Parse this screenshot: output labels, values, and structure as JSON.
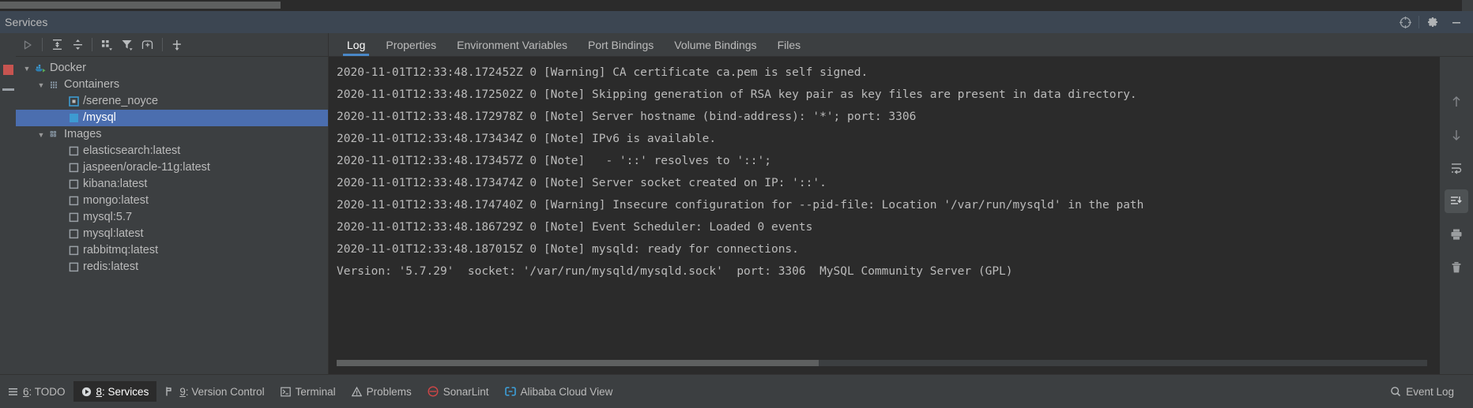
{
  "window": {
    "title": "Services",
    "header_actions": [
      {
        "name": "locate-icon",
        "label": "Locate"
      },
      {
        "name": "settings-gear-icon",
        "label": "Settings"
      },
      {
        "name": "minimize-icon",
        "label": "Hide"
      }
    ]
  },
  "left_toolbar": {
    "buttons": [
      {
        "name": "run-icon",
        "label": "Run"
      },
      {
        "name": "expand-all-icon",
        "label": "Expand All"
      },
      {
        "name": "collapse-all-icon",
        "label": "Collapse All"
      },
      {
        "name": "group-by-icon",
        "label": "Group By"
      },
      {
        "name": "filter-icon",
        "label": "Filter"
      },
      {
        "name": "add-tab-icon",
        "label": "Add Tab"
      },
      {
        "name": "add-service-icon",
        "label": "Add Service"
      }
    ]
  },
  "gutter": {
    "stop_label": "Stop",
    "hide_label": "Hide"
  },
  "tree": {
    "nodes": [
      {
        "label": "Docker",
        "indent": 0,
        "arrow": "expanded",
        "icon": "docker-icon",
        "selected": false
      },
      {
        "label": "Containers",
        "indent": 1,
        "arrow": "expanded",
        "icon": "containers-icon",
        "selected": false
      },
      {
        "label": "/serene_noyce",
        "indent": 2,
        "arrow": "none",
        "icon": "container-stopped-icon",
        "selected": false
      },
      {
        "label": "/mysql",
        "indent": 2,
        "arrow": "none",
        "icon": "container-running-icon",
        "selected": true
      },
      {
        "label": "Images",
        "indent": 1,
        "arrow": "expanded",
        "icon": "images-icon",
        "selected": false
      },
      {
        "label": "elasticsearch:latest",
        "indent": 2,
        "arrow": "none",
        "icon": "image-icon",
        "selected": false
      },
      {
        "label": "jaspeen/oracle-11g:latest",
        "indent": 2,
        "arrow": "none",
        "icon": "image-icon",
        "selected": false
      },
      {
        "label": "kibana:latest",
        "indent": 2,
        "arrow": "none",
        "icon": "image-icon",
        "selected": false
      },
      {
        "label": "mongo:latest",
        "indent": 2,
        "arrow": "none",
        "icon": "image-icon",
        "selected": false
      },
      {
        "label": "mysql:5.7",
        "indent": 2,
        "arrow": "none",
        "icon": "image-icon",
        "selected": false
      },
      {
        "label": "mysql:latest",
        "indent": 2,
        "arrow": "none",
        "icon": "image-icon",
        "selected": false
      },
      {
        "label": "rabbitmq:latest",
        "indent": 2,
        "arrow": "none",
        "icon": "image-icon",
        "selected": false
      },
      {
        "label": "redis:latest",
        "indent": 2,
        "arrow": "none",
        "icon": "image-icon",
        "selected": false
      }
    ]
  },
  "tabs": [
    {
      "label": "Log",
      "active": true
    },
    {
      "label": "Properties",
      "active": false
    },
    {
      "label": "Environment Variables",
      "active": false
    },
    {
      "label": "Port Bindings",
      "active": false
    },
    {
      "label": "Volume Bindings",
      "active": false
    },
    {
      "label": "Files",
      "active": false
    }
  ],
  "console": {
    "lines": [
      "2020-11-01T12:33:48.172452Z 0 [Warning] CA certificate ca.pem is self signed.",
      "2020-11-01T12:33:48.172502Z 0 [Note] Skipping generation of RSA key pair as key files are present in data directory.",
      "2020-11-01T12:33:48.172978Z 0 [Note] Server hostname (bind-address): '*'; port: 3306",
      "2020-11-01T12:33:48.173434Z 0 [Note] IPv6 is available.",
      "2020-11-01T12:33:48.173457Z 0 [Note]   - '::' resolves to '::';",
      "2020-11-01T12:33:48.173474Z 0 [Note] Server socket created on IP: '::'.",
      "2020-11-01T12:33:48.174740Z 0 [Warning] Insecure configuration for --pid-file: Location '/var/run/mysqld' in the path ",
      "2020-11-01T12:33:48.186729Z 0 [Note] Event Scheduler: Loaded 0 events",
      "2020-11-01T12:33:48.187015Z 0 [Note] mysqld: ready for connections.",
      "Version: '5.7.29'  socket: '/var/run/mysqld/mysqld.sock'  port: 3306  MySQL Community Server (GPL)"
    ],
    "side_buttons": [
      {
        "name": "scroll-up-icon",
        "label": "Up",
        "active": false
      },
      {
        "name": "scroll-down-icon",
        "label": "Down",
        "active": false
      },
      {
        "name": "soft-wrap-icon",
        "label": "Soft-Wrap",
        "active": false
      },
      {
        "name": "scroll-to-end-icon",
        "label": "Scroll to End",
        "active": true
      },
      {
        "name": "print-icon",
        "label": "Print",
        "active": false
      },
      {
        "name": "trash-icon",
        "label": "Clear All",
        "active": false
      }
    ]
  },
  "statusbar": {
    "items": [
      {
        "num": "6",
        "label": ": TODO",
        "icon": "todo-icon",
        "active": false
      },
      {
        "num": "8",
        "label": ": Services",
        "icon": "services-icon",
        "active": true
      },
      {
        "num": "9",
        "label": ": Version Control",
        "icon": "version-control-icon",
        "active": false
      },
      {
        "num": "",
        "label": "Terminal",
        "icon": "terminal-icon",
        "active": false
      },
      {
        "num": "",
        "label": "Problems",
        "icon": "problems-icon",
        "active": false
      },
      {
        "num": "",
        "label": "SonarLint",
        "icon": "sonarlint-icon",
        "active": false
      },
      {
        "num": "",
        "label": "Alibaba Cloud View",
        "icon": "alibaba-cloud-icon",
        "active": false
      }
    ],
    "event_log": {
      "label": "Event Log",
      "icon": "event-log-icon"
    }
  },
  "colors": {
    "accent": "#4a88c7",
    "selection": "#4b6eaf",
    "console_bg": "#2b2b2b",
    "panel_bg": "#3c3f41",
    "header_bg": "#3c4652",
    "stop_red": "#c75450",
    "docker_blue": "#3d9ad1"
  }
}
